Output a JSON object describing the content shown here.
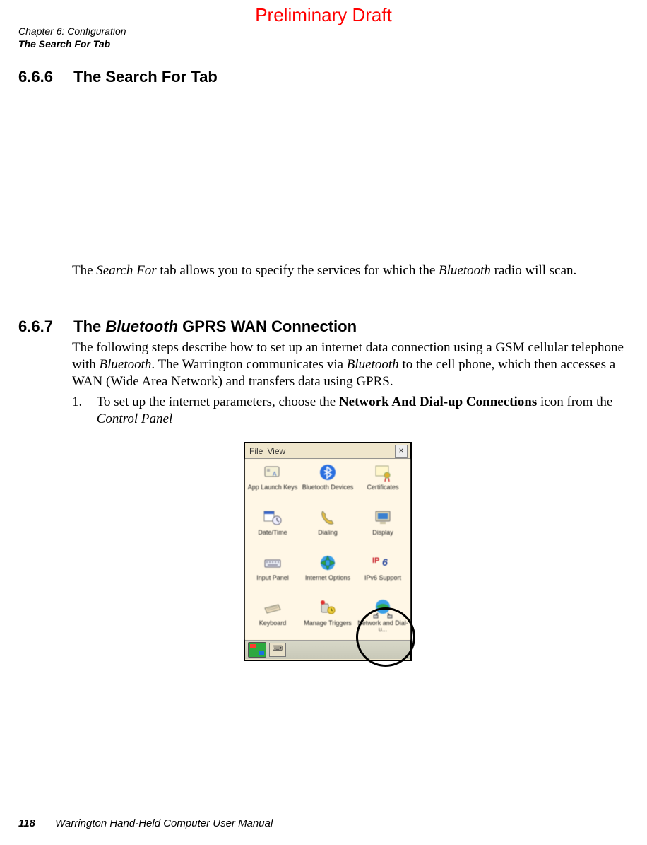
{
  "watermark": "Preliminary Draft",
  "running_head": {
    "line1": "Chapter 6: Configuration",
    "line2": "The Search For Tab"
  },
  "sections": {
    "s666": {
      "number": "6.6.6",
      "title": "The Search For Tab",
      "para_pre": "The ",
      "para_em1": "Search For",
      "para_mid": " tab allows you to specify the services for which the ",
      "para_em2": "Bluetooth",
      "para_post": " radio will scan."
    },
    "s667": {
      "number": "6.6.7",
      "title_pre": "The ",
      "title_em": "Bluetooth",
      "title_post": " GPRS WAN Connection",
      "para_pre": "The following steps describe how to set up an internet data connection using a GSM cellular telephone with ",
      "para_em1": "Bluetooth",
      "para_mid": ". The Warrington communicates via ",
      "para_em2": "Bluetooth",
      "para_post": " to the cell phone, which then accesses a WAN (Wide Area Network) and transfers data using GPRS.",
      "step1_num": "1.",
      "step1_pre": "To set up the internet parameters, choose the ",
      "step1_bold": "Network And Dial-up Connections",
      "step1_mid": " icon from the ",
      "step1_em": "Control Panel"
    }
  },
  "control_panel": {
    "menu_file": "File",
    "menu_view": "View",
    "close": "×",
    "taskbtn": "⌨",
    "items": [
      "App Launch Keys",
      "Bluetooth Devices",
      "Certificates",
      "Date/Time",
      "Dialing",
      "Display",
      "Input Panel",
      "Internet Options",
      "IPv6 Support",
      "Keyboard",
      "Manage Triggers",
      "Network and Dial-u..."
    ]
  },
  "footer": {
    "page": "118",
    "title": "Warrington Hand-Held Computer User Manual"
  }
}
